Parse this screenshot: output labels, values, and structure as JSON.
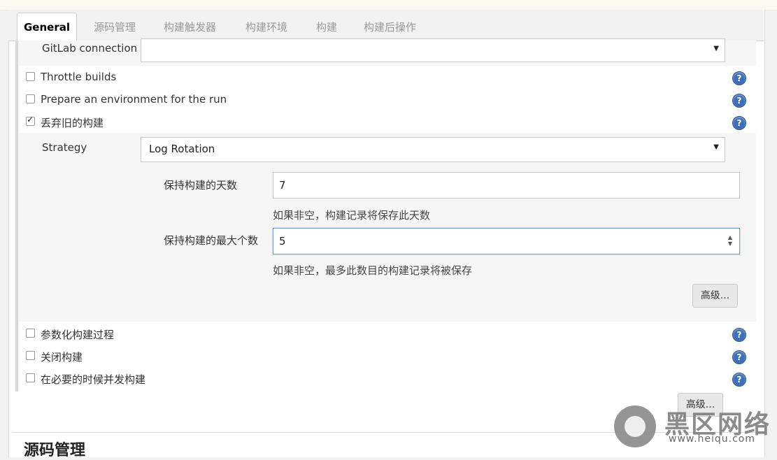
{
  "tabs": [
    "General",
    "源码管理",
    "构建触发器",
    "构建环境",
    "构建",
    "构建后操作"
  ],
  "gitlab": {
    "label": "GitLab connection",
    "value": ""
  },
  "options_top": [
    {
      "label": "Throttle builds",
      "checked": false
    },
    {
      "label": "Prepare an environment for the run",
      "checked": false
    },
    {
      "label": "丢弃旧的构建",
      "checked": true
    }
  ],
  "strategy": {
    "label": "Strategy",
    "value": "Log Rotation"
  },
  "days": {
    "label": "保持构建的天数",
    "value": "7",
    "hint": "如果非空，构建记录将保存此天数"
  },
  "max": {
    "label": "保持构建的最大个数",
    "value": "5",
    "hint": "如果非空，最多此数目的构建记录将被保存"
  },
  "advanced_inner": "高级...",
  "options_bottom": [
    {
      "label": "参数化构建过程",
      "checked": false
    },
    {
      "label": "关闭构建",
      "checked": false
    },
    {
      "label": "在必要的时候并发构建",
      "checked": false
    }
  ],
  "advanced_outer": "高级...",
  "next_section": "源码管理",
  "help_glyph": "?",
  "dropdown_glyph": "▼",
  "watermark": {
    "name": "黑区网络",
    "url": "www.heiqu.com"
  },
  "colors": {
    "help_blue": "#3f6fb6",
    "focus_border": "#6f9fd8",
    "panel_bg": "#f6f6f6"
  }
}
